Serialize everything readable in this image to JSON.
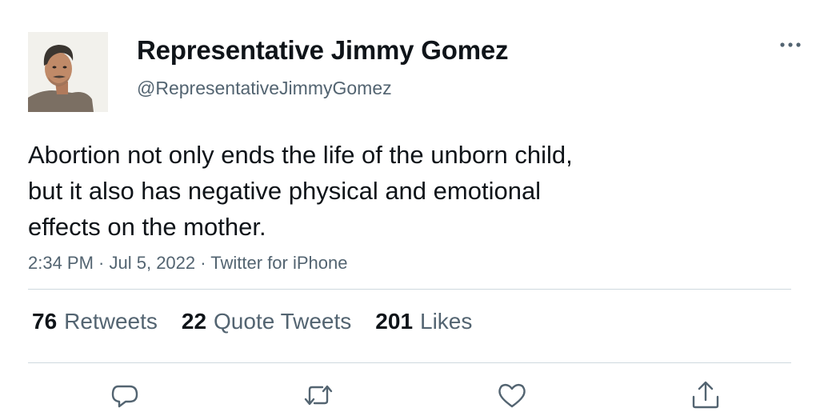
{
  "author": {
    "display_name": "Representative Jimmy Gomez",
    "handle": "@RepresentativeJimmyGomez"
  },
  "tweet": {
    "lines": [
      "Abortion not only ends the life of the unborn child,",
      "but it also has negative physical and emotional",
      "effects on the mother."
    ],
    "time": "2:34 PM",
    "date": "Jul 5, 2022",
    "source": "Twitter for iPhone",
    "separator": " · "
  },
  "stats": [
    {
      "count": "76",
      "label": "Retweets"
    },
    {
      "count": "22",
      "label": "Quote Tweets"
    },
    {
      "count": "201",
      "label": "Likes"
    }
  ],
  "icons": {
    "more": "more-horizontal-icon",
    "reply": "reply-icon",
    "retweet": "retweet-icon",
    "like": "like-icon",
    "share": "share-icon"
  },
  "colors": {
    "text_primary": "#0f1419",
    "text_secondary": "#536471",
    "divider": "#cfd9de"
  }
}
